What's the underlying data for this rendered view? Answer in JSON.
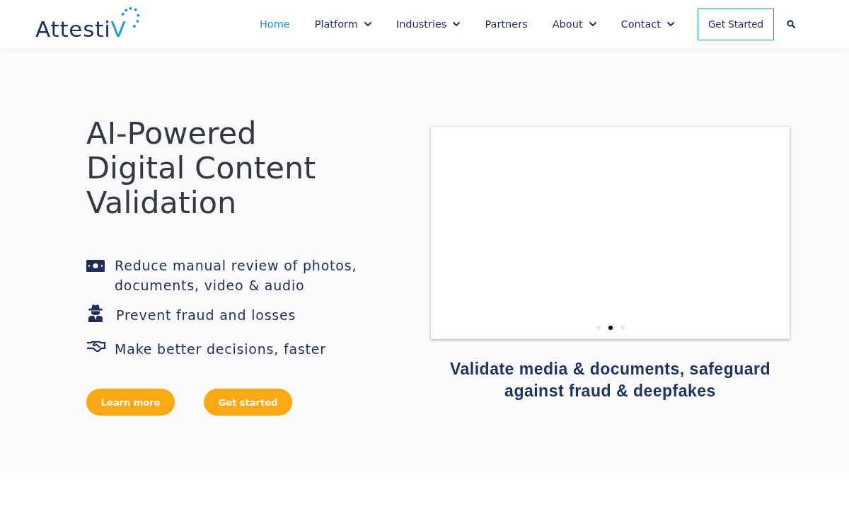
{
  "header": {
    "logo": {
      "name": "Attesti",
      "accent": "V"
    },
    "nav": [
      {
        "label": "Home",
        "selected": true,
        "has_menu": false
      },
      {
        "label": "Platform",
        "selected": false,
        "has_menu": true
      },
      {
        "label": "Industries",
        "selected": false,
        "has_menu": true
      },
      {
        "label": "Partners",
        "selected": false,
        "has_menu": false
      },
      {
        "label": "About",
        "selected": false,
        "has_menu": true
      },
      {
        "label": "Contact",
        "selected": false,
        "has_menu": true
      }
    ],
    "cta": "Get Started"
  },
  "hero": {
    "title": [
      "AI-Powered",
      "Digital Content",
      "Validation"
    ],
    "features": [
      {
        "kind": "money",
        "text": "Reduce manual review of photos, documents, video & audio"
      },
      {
        "kind": "spy",
        "text": "Prevent fraud and losses"
      },
      {
        "kind": "handshake",
        "text": "Make better decisions, faster"
      }
    ],
    "buttons": [
      "Learn more",
      "Get started"
    ],
    "carousel": {
      "dots": [
        {
          "selected": false
        },
        {
          "selected": true
        },
        {
          "selected": false
        }
      ]
    },
    "caption": "Validate media & documents, safeguard against fraud & deepfakes"
  }
}
